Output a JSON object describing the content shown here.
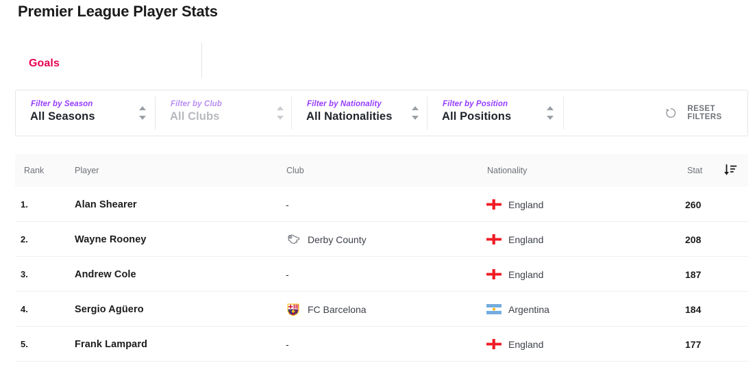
{
  "page": {
    "title": "Premier League Player Stats"
  },
  "stat_selector": {
    "name": "stat-type-select",
    "value": "Goals",
    "accent_color": "#e90052"
  },
  "filters": {
    "items": [
      {
        "label": "Filter by Season",
        "value": "All Seasons",
        "muted": false
      },
      {
        "label": "Filter by Club",
        "value": "All Clubs",
        "muted": true
      },
      {
        "label": "Filter by Nationality",
        "value": "All Nationalities",
        "muted": false
      },
      {
        "label": "Filter by Position",
        "value": "All Positions",
        "muted": false
      }
    ],
    "reset": {
      "label": "RESET FILTERS",
      "icon": "reset-arrow-icon"
    },
    "label_color": "#963cff"
  },
  "table": {
    "columns": [
      "Rank",
      "Player",
      "Club",
      "Nationality",
      "Stat"
    ],
    "sort": {
      "icon": "sort-descending-icon",
      "column": "Stat",
      "direction": "descending"
    },
    "rows": [
      {
        "rank": "1.",
        "player": "Alan Shearer",
        "club": "-",
        "club_badge": null,
        "nationality": "England",
        "flag": "flag-england",
        "stat": "260"
      },
      {
        "rank": "2.",
        "player": "Wayne Rooney",
        "club": "Derby County",
        "club_badge": "badge-derby-county",
        "nationality": "England",
        "flag": "flag-england",
        "stat": "208"
      },
      {
        "rank": "3.",
        "player": "Andrew Cole",
        "club": "-",
        "club_badge": null,
        "nationality": "England",
        "flag": "flag-england",
        "stat": "187"
      },
      {
        "rank": "4.",
        "player": "Sergio Agüero",
        "club": "FC Barcelona",
        "club_badge": "badge-fc-barcelona",
        "nationality": "Argentina",
        "flag": "flag-argentina",
        "stat": "184"
      },
      {
        "rank": "5.",
        "player": "Frank Lampard",
        "club": "-",
        "club_badge": null,
        "nationality": "England",
        "flag": "flag-england",
        "stat": "177"
      }
    ]
  }
}
